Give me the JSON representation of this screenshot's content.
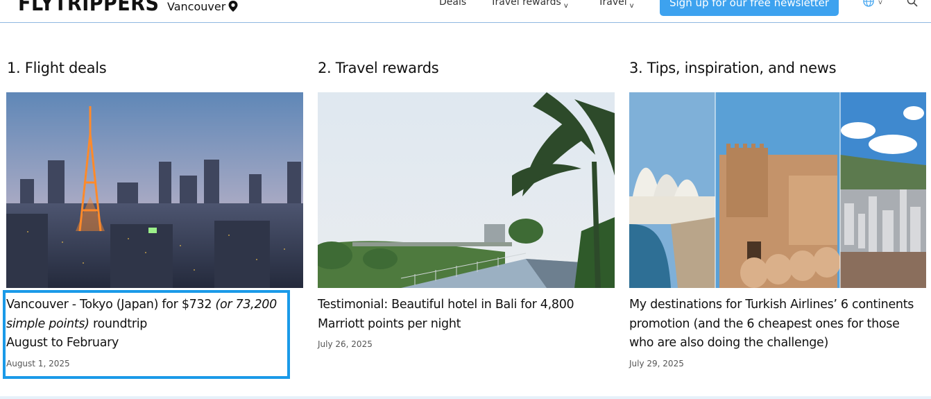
{
  "header": {
    "logo": "FLYTRIPPERS",
    "city": "Vancouver",
    "nav": [
      {
        "label": "Deals",
        "has_dropdown": false
      },
      {
        "label": "Travel rewards",
        "has_dropdown": true
      },
      {
        "label": "Travel",
        "has_dropdown": true
      }
    ],
    "newsletter_label": "Sign up for our free newsletter",
    "icons": [
      "map-pin-icon",
      "globe-icon",
      "search-icon"
    ]
  },
  "columns": [
    {
      "heading": "1. Flight deals",
      "post": {
        "title_a": "Vancouver - Tokyo (Japan) for $732",
        "title_italic": "(or 73,200 simple points)",
        "title_b": "roundtrip",
        "title_line2": "August to February",
        "date": "August 1, 2025"
      }
    },
    {
      "heading": "2. Travel rewards",
      "post": {
        "title": "Testimonial: Beautiful hotel in Bali for 4,800 Marriott points per night",
        "date": "July 26, 2025"
      }
    },
    {
      "heading": "3. Tips, inspiration, and news",
      "post": {
        "title": "My destinations for Turkish Airlines’ 6 continents promotion (and the 6 cheapest ones for those who are also doing the challenge)",
        "date": "July 29, 2025"
      }
    }
  ],
  "colors": {
    "accent": "#3da2ef",
    "highlight": "#1a9ae8"
  }
}
